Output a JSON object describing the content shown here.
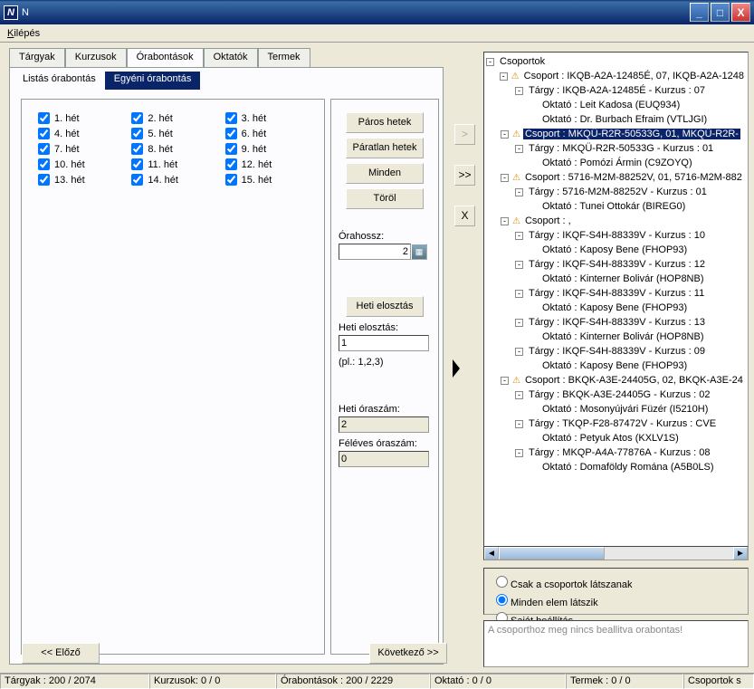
{
  "window": {
    "title": "N"
  },
  "menu": {
    "item0": "Kilépés"
  },
  "tabs": {
    "t0": "Tárgyak",
    "t1": "Kurzusok",
    "t2": "Órabontások",
    "t3": "Oktatók",
    "t4": "Termek"
  },
  "subtabs": {
    "s0": "Listás órabontás",
    "s1": "Egyéni órabontás"
  },
  "weeks": {
    "w1": "1. hét",
    "w2": "2. hét",
    "w3": "3. hét",
    "w4": "4. hét",
    "w5": "5. hét",
    "w6": "6. hét",
    "w7": "7. hét",
    "w8": "8. hét",
    "w9": "9. hét",
    "w10": "10. hét",
    "w11": "11. hét",
    "w12": "12. hét",
    "w13": "13. hét",
    "w14": "14. hét",
    "w15": "15. hét"
  },
  "buttons": {
    "paros": "Páros hetek",
    "paratlan": "Páratlan hetek",
    "minden": "Minden",
    "torol": "Töröl",
    "heti_elo": "Heti elosztás",
    "elozo": "<< Előző",
    "kovetkezo": "Következő >>"
  },
  "labels": {
    "orahossz": "Órahossz:",
    "heti_elosztas": "Heti elosztás:",
    "pl": "(pl.: 1,2,3)",
    "heti_oraszam": "Heti óraszám:",
    "feleves_oraszam": "Féléves óraszám:"
  },
  "values": {
    "orahossz": "2",
    "heti_elosztas": "1",
    "heti_oraszam": "2",
    "feleves_oraszam": "0"
  },
  "tree": {
    "root": "Csoportok",
    "n1": "Csoport : IKQB-A2A-12485É, 07, IKQB-A2A-1248",
    "n1a": "Tárgy : IKQB-A2A-12485É - Kurzus : 07",
    "n1a1": "Oktató : Leit Kadosa (EUQ934)",
    "n1a2": "Oktató : Dr. Burbach Efraim (VTLJGI)",
    "n2": "Csoport : MKQÜ-R2R-50533G, 01, MKQÜ-R2R-",
    "n2a": "Tárgy : MKQÜ-R2R-50533G - Kurzus : 01",
    "n2a1": "Oktató : Pomózi Ármin (C9ZOYQ)",
    "n3": "Csoport : 5716-M2M-88252V, 01, 5716-M2M-882",
    "n3a": "Tárgy : 5716-M2M-88252V - Kurzus : 01",
    "n3a1": "Oktató : Tunei Ottokár (BIREG0)",
    "n4": "Csoport : ,",
    "n4a": "Tárgy : IKQF-S4H-88339V - Kurzus : 10",
    "n4a1": "Oktató : Kaposy Bene (FHOP93)",
    "n4b": "Tárgy : IKQF-S4H-88339V - Kurzus : 12",
    "n4b1": "Oktató : Kinterner Bolivár (HOP8NB)",
    "n4c": "Tárgy : IKQF-S4H-88339V - Kurzus : 11",
    "n4c1": "Oktató : Kaposy Bene (FHOP93)",
    "n4d": "Tárgy : IKQF-S4H-88339V - Kurzus : 13",
    "n4d1": "Oktató : Kinterner Bolivár (HOP8NB)",
    "n4e": "Tárgy : IKQF-S4H-88339V - Kurzus : 09",
    "n4e1": "Oktató : Kaposy Bene (FHOP93)",
    "n5": "Csoport : BKQK-A3E-24405G, 02, BKQK-A3E-24",
    "n5a": "Tárgy : BKQK-A3E-24405G - Kurzus : 02",
    "n5a1": "Oktató : Mosonyújvári Füzér (I5210H)",
    "n5b": "Tárgy : TKQP-F28-87472V - Kurzus : CVE",
    "n5b1": "Oktató : Petyuk Atos (KXLV1S)",
    "n5c": "Tárgy : MKQP-A4A-77876A - Kurzus : 08",
    "n5c1": "Oktató : Domaföldy Romána (A5B0LS)"
  },
  "radios": {
    "r1": "Csak a csoportok látszanak",
    "r2": "Minden elem látszik",
    "r3": "Saját beállítás"
  },
  "info": "A csoporthoz meg nincs beallitva orabontas!",
  "status": {
    "s1": "Tárgyak : 200 / 2074",
    "s2": "Kurzusok: 0 / 0",
    "s3": "Órabontások : 200 / 2229",
    "s4": "Oktató : 0 / 0",
    "s5": "Termek : 0 / 0",
    "s6": "Csoportok s"
  },
  "midbtns": {
    "right": ">",
    "rightright": ">>",
    "x": "X"
  }
}
